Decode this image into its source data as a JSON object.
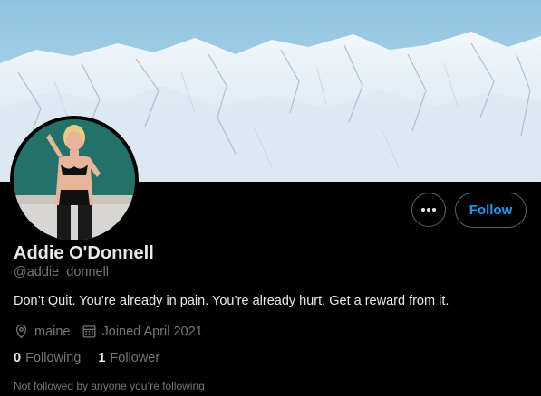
{
  "profile": {
    "display_name": "Addie O'Donnell",
    "handle": "@addie_donnell",
    "bio": "Don’t Quit. You’re already in pain. You’re already hurt. Get a reward from it.",
    "location": "maine",
    "joined": "Joined April 2021",
    "following_count": "0",
    "following_label": "Following",
    "followers_count": "1",
    "followers_label": "Follower",
    "followed_by_note": "Not followed by anyone you’re following"
  },
  "actions": {
    "follow_label": "Follow",
    "more_icon": "ellipsis-icon"
  },
  "icons": {
    "location": "location-pin-icon",
    "calendar": "calendar-icon"
  },
  "colors": {
    "background": "#000000",
    "accent": "#1d9bf0",
    "primary_text": "#e7e9ea",
    "secondary_text": "#71767b",
    "button_border": "#536471"
  }
}
